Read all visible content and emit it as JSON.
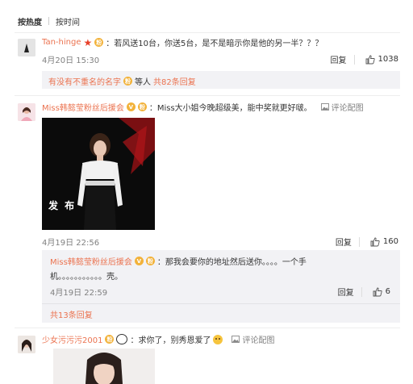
{
  "tabs": {
    "hot": "按热度",
    "time": "按时间"
  },
  "actions": {
    "reply": "回复"
  },
  "comment1": {
    "user": "Tan-hinge",
    "text": "：若风送10台，你送5台，是不是暗示你是他的另一半？？？",
    "time": "4月20日 15:30",
    "likes": "1038",
    "reply_preview": {
      "user": "有没有不重名的名字",
      "middle": "等人",
      "count": "共82条回复"
    }
  },
  "comment2": {
    "user": "Miss韩懿莹粉丝后援会",
    "text": "：Miss大小姐今晚超级美，能中奖就更好啵。",
    "pic_label": "评论配图",
    "photo_text": "发 布",
    "time": "4月19日 22:56",
    "likes": "160",
    "sub_reply": {
      "user": "Miss韩懿莹粉丝后援会",
      "text1": "：那我会要你的地址然后送你。。。。一个手",
      "text2": "机。。。。。。。。。。。壳。",
      "time": "4月19日 22:59",
      "likes": "6"
    },
    "more_replies": "共13条回复"
  },
  "comment3": {
    "user": "少女污污污2001",
    "text": "：求你了，别秀恩爱了",
    "pic_label": "评论配图"
  },
  "colors": {
    "accent": "#eb7350",
    "reply_bg": "#f2f2f5",
    "muted": "#808080"
  }
}
